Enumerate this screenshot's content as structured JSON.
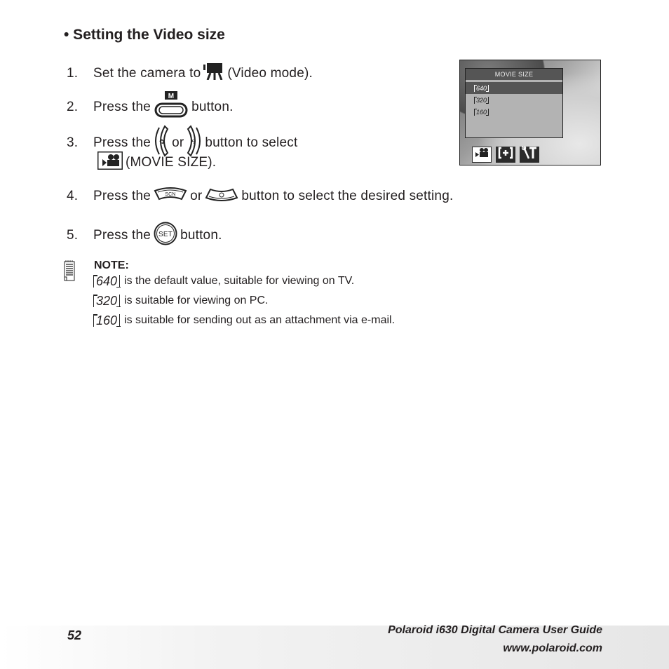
{
  "heading": "• Setting the Video size",
  "steps": [
    {
      "num": "1.",
      "before": "Set the camera to",
      "icon": "video-mode-icon",
      "after": "(Video mode)."
    },
    {
      "num": "2.",
      "before": "Press the",
      "icon": "menu-m-button-icon",
      "icon_label": "M",
      "after": "button."
    },
    {
      "num": "3.",
      "before": "Press the",
      "icon": "left-macro-button-icon",
      "mid": "or",
      "icon2": "right-flash-button-icon",
      "after": "button to select",
      "line2_icon": "movie-camera-icon",
      "line2": "(MOVIE SIZE)."
    },
    {
      "num": "4.",
      "before": "Press the",
      "icon": "up-scn-button-icon",
      "icon_label": "SCN",
      "mid": "or",
      "icon2": "down-timer-button-icon",
      "after": "button to select the desired setting."
    },
    {
      "num": "5.",
      "before": "Press the",
      "icon": "set-button-icon",
      "icon_label": "SET",
      "after": "button."
    }
  ],
  "screen": {
    "menu_title": "MOVIE SIZE",
    "options": [
      "640",
      "320",
      "160"
    ],
    "selected": "640",
    "tabs": [
      {
        "icon": "movie-camera-icon",
        "active": true
      },
      {
        "icon": "exposure-bracket-icon",
        "label": "[+]",
        "active": false
      },
      {
        "icon": "setup-tools-icon",
        "active": false
      }
    ]
  },
  "note": {
    "label": "NOTE:",
    "items": [
      {
        "tag": "640",
        "text": "is the default value, suitable for viewing on TV."
      },
      {
        "tag": "320",
        "text": "is suitable for viewing on PC."
      },
      {
        "tag": "160",
        "text": "is suitable for sending out as an attachment via e-mail."
      }
    ]
  },
  "footer": {
    "page_number": "52",
    "guide_title": "Polaroid i630 Digital Camera User Guide",
    "url": "www.polaroid.com"
  }
}
